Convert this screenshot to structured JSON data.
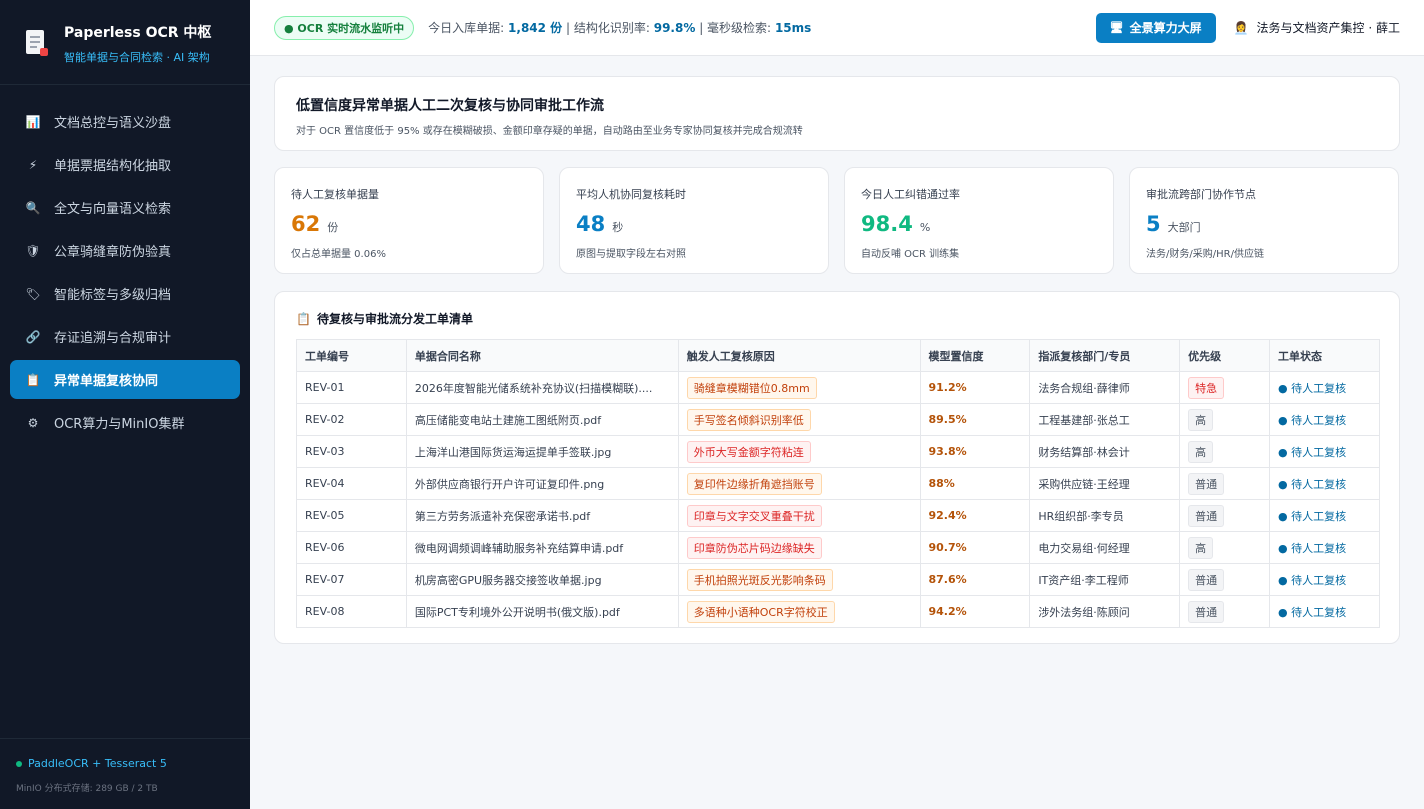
{
  "brand": {
    "title": "Paperless OCR 中枢",
    "subtitle": "智能单据与合同检索 · AI 架构"
  },
  "nav": [
    {
      "label": "文档总控与语义沙盘",
      "icon": "bar-chart-icon",
      "glyph": "📊"
    },
    {
      "label": "单据票据结构化抽取",
      "icon": "lightning-icon",
      "glyph": "⚡"
    },
    {
      "label": "全文与向量语义检索",
      "icon": "search-icon",
      "glyph": "🔍"
    },
    {
      "label": "公章骑缝章防伪验真",
      "icon": "shield-icon",
      "glyph": "🛡"
    },
    {
      "label": "智能标签与多级归档",
      "icon": "tag-icon",
      "glyph": "🏷"
    },
    {
      "label": "存证追溯与合规审计",
      "icon": "link-icon",
      "glyph": "🔗"
    },
    {
      "label": "异常单据复核协同",
      "icon": "clipboard-icon",
      "glyph": "📋",
      "active": true
    },
    {
      "label": "OCR算力与MinIO集群",
      "icon": "gear-icon",
      "glyph": "⚙"
    }
  ],
  "footer": {
    "engine": "PaddleOCR + Tesseract 5",
    "storage": "MinIO 分布式存储: 289 GB / 2 TB"
  },
  "topbar": {
    "live_badge": "● OCR 实时流水监听中",
    "stat1_label": "今日入库单据:",
    "stat1_value": "1,842 份",
    "stat2_label": "| 结构化识别率:",
    "stat2_value": "99.8%",
    "stat3_label": "| 毫秒级检索:",
    "stat3_value": "15ms",
    "screen_button": "全景算力大屏",
    "user": "法务与文档资产集控 · 薛工"
  },
  "header": {
    "title": "低置信度异常单据人工二次复核与协同审批工作流",
    "desc": "对于 OCR 置信度低于 95% 或存在模糊破损、金额印章存疑的单据，自动路由至业务专家协同复核并完成合规流转"
  },
  "stats": [
    {
      "label": "待人工复核单据量",
      "value": "62",
      "unit": "份",
      "note": "仅占总单据量 0.06%",
      "color": "#d97706"
    },
    {
      "label": "平均人机协同复核耗时",
      "value": "48",
      "unit": "秒",
      "note": "原图与提取字段左右对照",
      "color": "#0a7fc4"
    },
    {
      "label": "今日人工纠错通过率",
      "value": "98.4",
      "unit": "%",
      "note": "自动反哺 OCR 训练集",
      "color": "#10b981"
    },
    {
      "label": "审批流跨部门协作节点",
      "value": "5",
      "unit": "大部门",
      "note": "法务/财务/采购/HR/供应链",
      "color": "#0a7fc4"
    }
  ],
  "table": {
    "title": "待复核与审批流分发工单清单",
    "columns": [
      "工单编号",
      "单据合同名称",
      "触发人工复核原因",
      "模型置信度",
      "指派复核部门/专员",
      "优先级",
      "工单状态"
    ],
    "rows": [
      {
        "id": "REV-01",
        "name": "2026年度智能光储系统补充协议(扫描模糊联)....",
        "reason": "骑缝章模糊错位0.8mm",
        "reason_type": "orange",
        "conf": "91.2%",
        "dept": "法务合规组·薛律师",
        "prio": "特急",
        "prio_type": "urgent",
        "status": "● 待人工复核"
      },
      {
        "id": "REV-02",
        "name": "高压储能变电站土建施工图纸附页.pdf",
        "reason": "手写签名倾斜识别率低",
        "reason_type": "orange",
        "conf": "89.5%",
        "dept": "工程基建部·张总工",
        "prio": "高",
        "prio_type": "normal",
        "status": "● 待人工复核"
      },
      {
        "id": "REV-03",
        "name": "上海洋山港国际货运海运提单手签联.jpg",
        "reason": "外币大写金额字符粘连",
        "reason_type": "red",
        "conf": "93.8%",
        "dept": "财务结算部·林会计",
        "prio": "高",
        "prio_type": "normal",
        "status": "● 待人工复核"
      },
      {
        "id": "REV-04",
        "name": "外部供应商银行开户许可证复印件.png",
        "reason": "复印件边缘折角遮挡账号",
        "reason_type": "orange",
        "conf": "88%",
        "dept": "采购供应链·王经理",
        "prio": "普通",
        "prio_type": "normal",
        "status": "● 待人工复核"
      },
      {
        "id": "REV-05",
        "name": "第三方劳务派遣补充保密承诺书.pdf",
        "reason": "印章与文字交叉重叠干扰",
        "reason_type": "red",
        "conf": "92.4%",
        "dept": "HR组织部·李专员",
        "prio": "普通",
        "prio_type": "normal",
        "status": "● 待人工复核"
      },
      {
        "id": "REV-06",
        "name": "微电网调频调峰辅助服务补充结算申请.pdf",
        "reason": "印章防伪芯片码边缘缺失",
        "reason_type": "red",
        "conf": "90.7%",
        "dept": "电力交易组·何经理",
        "prio": "高",
        "prio_type": "normal",
        "status": "● 待人工复核"
      },
      {
        "id": "REV-07",
        "name": "机房高密GPU服务器交接签收单据.jpg",
        "reason": "手机拍照光斑反光影响条码",
        "reason_type": "orange",
        "conf": "87.6%",
        "dept": "IT资产组·李工程师",
        "prio": "普通",
        "prio_type": "normal",
        "status": "● 待人工复核"
      },
      {
        "id": "REV-08",
        "name": "国际PCT专利境外公开说明书(俄文版).pdf",
        "reason": "多语种小语种OCR字符校正",
        "reason_type": "orange",
        "conf": "94.2%",
        "dept": "涉外法务组·陈顾问",
        "prio": "普通",
        "prio_type": "normal",
        "status": "● 待人工复核"
      }
    ]
  }
}
